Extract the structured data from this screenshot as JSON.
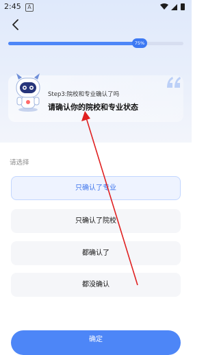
{
  "status_bar": {
    "time": "2:45",
    "notif_letter": "A"
  },
  "progress": {
    "fraction": 0.75,
    "label": "75%"
  },
  "header": {
    "step": "Step3:院校和专业确认了吗",
    "title": "请确认你的院校和专业状态"
  },
  "prompt": "请选择",
  "options": [
    {
      "label": "只确认了专业",
      "selected": true
    },
    {
      "label": "只确认了院校",
      "selected": false
    },
    {
      "label": "都确认了",
      "selected": false
    },
    {
      "label": "都没确认",
      "selected": false
    }
  ],
  "confirm_label": "确定",
  "colors": {
    "accent": "#4d86f7",
    "annotation": "#e02020"
  }
}
